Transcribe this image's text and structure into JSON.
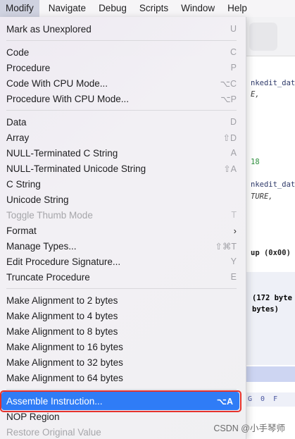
{
  "menubar": {
    "items": [
      "Modify",
      "Navigate",
      "Debug",
      "Scripts",
      "Window",
      "Help"
    ]
  },
  "background_code": {
    "lines": [
      "nkedit_dat",
      "E,",
      "18",
      "nkedit_dat",
      "TURE,",
      "up (0x00)",
      "(172 byte",
      "bytes)"
    ],
    "hex_row": "G  0  F"
  },
  "menu": {
    "items": [
      {
        "label": "Mark as Unexplored",
        "shortcut": "U"
      },
      {
        "label": "Code",
        "shortcut": "C"
      },
      {
        "label": "Procedure",
        "shortcut": "P"
      },
      {
        "label": "Code With CPU Mode...",
        "shortcut": "⌥C"
      },
      {
        "label": "Procedure With CPU Mode...",
        "shortcut": "⌥P"
      },
      {
        "label": "Data",
        "shortcut": "D"
      },
      {
        "label": "Array",
        "shortcut": "⇧D"
      },
      {
        "label": "NULL-Terminated C String",
        "shortcut": "A"
      },
      {
        "label": "NULL-Terminated Unicode String",
        "shortcut": "⇧A"
      },
      {
        "label": "C String",
        "shortcut": ""
      },
      {
        "label": "Unicode String",
        "shortcut": ""
      },
      {
        "label": "Toggle Thumb Mode",
        "shortcut": "T"
      },
      {
        "label": "Format",
        "shortcut": ""
      },
      {
        "label": "Manage Types...",
        "shortcut": "⇧⌘T"
      },
      {
        "label": "Edit Procedure Signature...",
        "shortcut": "Y"
      },
      {
        "label": "Truncate Procedure",
        "shortcut": "E"
      },
      {
        "label": "Make Alignment to 2 bytes",
        "shortcut": ""
      },
      {
        "label": "Make Alignment to 4 bytes",
        "shortcut": ""
      },
      {
        "label": "Make Alignment to 8 bytes",
        "shortcut": ""
      },
      {
        "label": "Make Alignment to 16 bytes",
        "shortcut": ""
      },
      {
        "label": "Make Alignment to 32 bytes",
        "shortcut": ""
      },
      {
        "label": "Make Alignment to 64 bytes",
        "shortcut": ""
      },
      {
        "label": "Assemble Instruction...",
        "shortcut": "⌥A"
      },
      {
        "label": "NOP Region",
        "shortcut": ""
      },
      {
        "label": "Restore Original Value",
        "shortcut": ""
      }
    ],
    "submenu_arrow": "›"
  },
  "watermark": "CSDN @小手琴师",
  "colors": {
    "highlight": "#2f7cf6",
    "highlight_outline": "#e5322c",
    "menu_bg": "#f0eff2"
  }
}
